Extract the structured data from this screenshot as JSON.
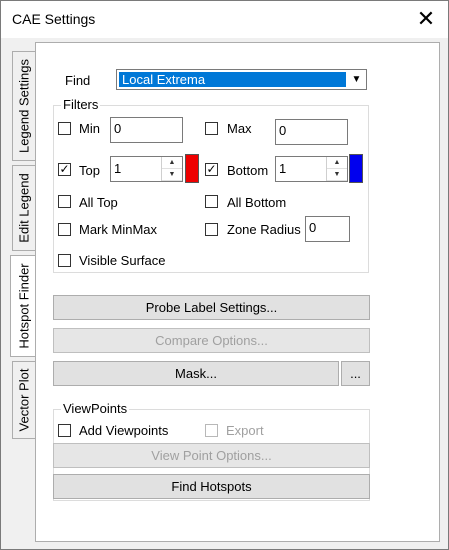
{
  "window": {
    "title": "CAE Settings",
    "close_symbol": "✕"
  },
  "tabs": [
    {
      "label": "Legend Settings",
      "active": false
    },
    {
      "label": "Edit Legend",
      "active": false
    },
    {
      "label": "Hotspot Finder",
      "active": true
    },
    {
      "label": "Vector Plot",
      "active": false
    }
  ],
  "find": {
    "label": "Find",
    "value": "Local Extrema"
  },
  "filters": {
    "title": "Filters",
    "min": {
      "label": "Min",
      "checked": false,
      "value": "0"
    },
    "max": {
      "label": "Max",
      "checked": false,
      "value": "0"
    },
    "top": {
      "label": "Top",
      "checked": true,
      "value": "1",
      "color": "#ee0000"
    },
    "bottom": {
      "label": "Bottom",
      "checked": true,
      "value": "1",
      "color": "#0000ee"
    },
    "all_top": {
      "label": "All Top",
      "checked": false
    },
    "all_bottom": {
      "label": "All Bottom",
      "checked": false
    },
    "mark_minmax": {
      "label": "Mark MinMax",
      "checked": false
    },
    "zone_radius": {
      "label": "Zone Radius",
      "checked": false,
      "value": "0"
    },
    "visible_surface": {
      "label": "Visible Surface",
      "checked": false
    }
  },
  "buttons": {
    "probe_label": "Probe Label Settings...",
    "compare": "Compare Options...",
    "mask": "Mask...",
    "mask_more": "...",
    "view_point_options": "View Point Options...",
    "find_hotspots": "Find Hotspots"
  },
  "viewpoints": {
    "title": "ViewPoints",
    "add": {
      "label": "Add Viewpoints",
      "checked": false
    },
    "export": {
      "label": "Export",
      "checked": false
    }
  },
  "check_symbol": "✓"
}
